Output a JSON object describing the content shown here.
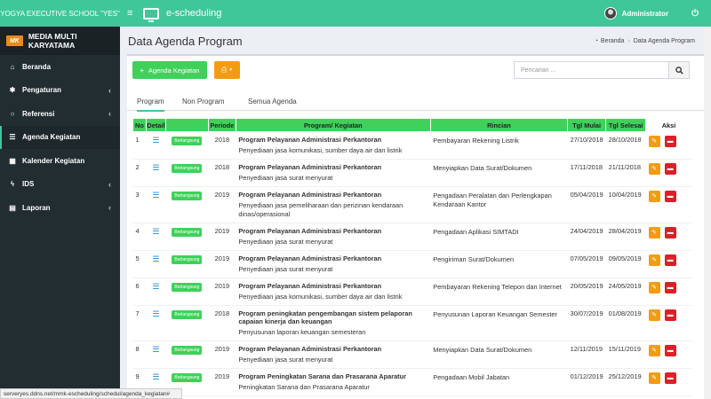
{
  "school": "YOGYA EXECUTIVE SCHOOL \"YES\"",
  "app_title": "e-scheduling",
  "user": "Administrator",
  "logo": {
    "mark": "MK",
    "name": "MEDIA MULTI KARYATAMA"
  },
  "sidebar": [
    {
      "label": "Beranda",
      "icon": "home-icon",
      "glyph": "⌂",
      "arrow": false,
      "active": false
    },
    {
      "label": "Pengaturan",
      "icon": "gear-icon",
      "glyph": "✱",
      "arrow": true,
      "active": false
    },
    {
      "label": "Referensi",
      "icon": "circle-icon",
      "glyph": "○",
      "arrow": true,
      "active": false
    },
    {
      "label": "Agenda Kegiatan",
      "icon": "list-icon",
      "glyph": "☰",
      "arrow": false,
      "active": true
    },
    {
      "label": "Kalender Kegiatan",
      "icon": "calendar-icon",
      "glyph": "▦",
      "arrow": false,
      "active": false
    },
    {
      "label": "IDS",
      "icon": "bolt-icon",
      "glyph": "ϟ",
      "arrow": true,
      "active": false
    },
    {
      "label": "Laporan",
      "icon": "file-icon",
      "glyph": "▤",
      "arrow": true,
      "active": false
    }
  ],
  "page": {
    "title": "Data Agenda Program",
    "breadcrumb": [
      "Beranda",
      "Data Agenda Program"
    ]
  },
  "toolbar": {
    "add_label": "Agenda Kegiatan",
    "search_placeholder": "Pencarian ..."
  },
  "tabs": [
    "Program",
    "Non Program",
    "Semua Agenda"
  ],
  "table": {
    "headers": [
      "No",
      "Detail",
      "",
      "Periode",
      "Program/ Kegiatan",
      "Rincian",
      "Tgl Mulai",
      "Tgl Selesai",
      "Aksi"
    ],
    "rows": [
      {
        "no": "1",
        "status": "Berlangsung",
        "periode": "2018",
        "program": "Program Pelayanan Administrasi Perkantoran",
        "kegiatan": "Penyediaan jasa komunikasi, sumber daya air dan listrik",
        "rincian": "Pembayaran Rekening Listrik",
        "mulai": "27/10/2018",
        "selesai": "28/10/2018"
      },
      {
        "no": "2",
        "status": "Berlangsung",
        "periode": "2018",
        "program": "Program Pelayanan Administrasi Perkantoran",
        "kegiatan": "Penyediaan jasa surat menyurat",
        "rincian": "Menyiapkan Data Surat/Dokumen",
        "mulai": "17/11/2018",
        "selesai": "21/11/2018"
      },
      {
        "no": "3",
        "status": "Berlangsung",
        "periode": "2019",
        "program": "Program Pelayanan Administrasi Perkantoran",
        "kegiatan": "Penyediaan jasa pemeliharaan dan perizinan kendaraan dinas/operasional",
        "rincian": "Pengadaan Peralatan dan Perlengkapan Kendaraan Kantor",
        "mulai": "05/04/2019",
        "selesai": "10/04/2019"
      },
      {
        "no": "4",
        "status": "Berlangsung",
        "periode": "2019",
        "program": "Program Pelayanan Administrasi Perkantoran",
        "kegiatan": "Penyediaan jasa surat menyurat",
        "rincian": "Pengadaan Aplikasi SIMTADI",
        "mulai": "24/04/2019",
        "selesai": "28/04/2019"
      },
      {
        "no": "5",
        "status": "Berlangsung",
        "periode": "2019",
        "program": "Program Pelayanan Administrasi Perkantoran",
        "kegiatan": "Penyediaan jasa surat menyurat",
        "rincian": "Pengiriman Surat/Dokumen",
        "mulai": "07/05/2019",
        "selesai": "09/05/2019"
      },
      {
        "no": "6",
        "status": "Berlangsung",
        "periode": "2019",
        "program": "Program Pelayanan Administrasi Perkantoran",
        "kegiatan": "Penyediaan jasa komunikasi, sumber daya air dan listrik",
        "rincian": "Pembayaran Rekening Telepon dan Internet",
        "mulai": "20/05/2019",
        "selesai": "24/05/2019"
      },
      {
        "no": "7",
        "status": "Berlangsung",
        "periode": "2018",
        "program": "Program peningkatan pengembangan sistem pelaporan capaian kinerja dan keuangan",
        "kegiatan": "Penyusunan laporan keuangan semesteran",
        "rincian": "Penyusunan Laporan Keuangan Semester",
        "mulai": "30/07/2019",
        "selesai": "01/08/2019"
      },
      {
        "no": "8",
        "status": "Berlangsung",
        "periode": "2019",
        "program": "Program Pelayanan Administrasi Perkantoran",
        "kegiatan": "Penyediaan jasa surat menyurat",
        "rincian": "Menyiapkan Data Surat/Dokumen",
        "mulai": "12/11/2019",
        "selesai": "15/11/2019"
      },
      {
        "no": "9",
        "status": "Berlangsung",
        "periode": "2019",
        "program": "Program Peningkatan Sarana dan Prasarana Aparatur",
        "kegiatan": "Peningkatan Sarana dan Prasarana Aparatur",
        "rincian": "Pengadaan Mobil Jabatan",
        "mulai": "01/12/2019",
        "selesai": "25/12/2019"
      }
    ]
  },
  "status_url": "serveryes.ddns.net/mmk-escheduling/schedul/agenda_kegiatan#"
}
